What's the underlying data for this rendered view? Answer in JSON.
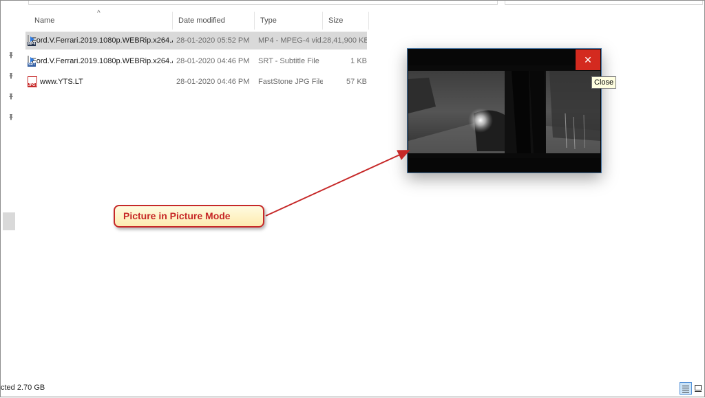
{
  "columns": {
    "name": "Name",
    "date": "Date modified",
    "type": "Type",
    "size": "Size"
  },
  "files": [
    {
      "name": "Ford.V.Ferrari.2019.1080p.WEBRip.x264.A...",
      "date": "28-01-2020 05:52 PM",
      "type": "MP4 - MPEG-4 vid...",
      "size": "28,41,900 KB",
      "icon": "mp4-file-icon",
      "icon_tag": "MP4",
      "selected": true
    },
    {
      "name": "Ford.V.Ferrari.2019.1080p.WEBRip.x264.A...",
      "date": "28-01-2020 04:46 PM",
      "type": "SRT - Subtitle File",
      "size": "1 KB",
      "icon": "srt-file-icon",
      "icon_tag": "SRT",
      "selected": false
    },
    {
      "name": "www.YTS.LT",
      "date": "28-01-2020 04:46 PM",
      "type": "FastStone JPG File",
      "size": "57 KB",
      "icon": "jpg-file-icon",
      "icon_tag": "JPG",
      "selected": false
    }
  ],
  "pip": {
    "close_glyph": "✕",
    "tooltip": "Close"
  },
  "annotation": {
    "label": "Picture in Picture Mode",
    "color": "#c62828"
  },
  "status": {
    "text": "cted  2.70 GB"
  },
  "colors": {
    "selection": "#d9d9d9",
    "close_red": "#d42a1f",
    "view_active": "#cce4f7"
  }
}
